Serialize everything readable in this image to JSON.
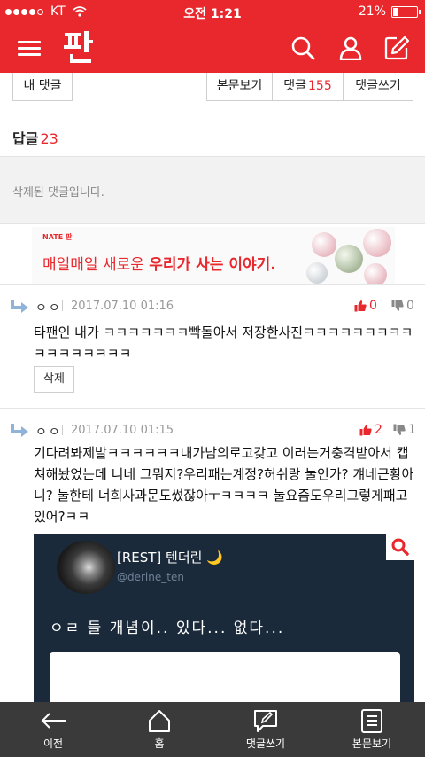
{
  "status_bar": {
    "carrier": "KT",
    "time": "오전 1:21",
    "battery": "21%",
    "battery_level": 0.21
  },
  "header": {
    "logo": "판",
    "icons": [
      "menu-icon",
      "search-icon",
      "user-icon",
      "edit-icon"
    ]
  },
  "buttons": {
    "my_comments": "내 댓글",
    "view_post": "본문보기",
    "comments_label": "댓글",
    "comments_count": "155",
    "write_comment": "댓글쓰기"
  },
  "replies": {
    "label": "답글",
    "count": "23"
  },
  "deleted_notice": "삭제된 댓글입니다.",
  "ad": {
    "brand": "NATE 판",
    "text_plain": "매일매일 새로운 ",
    "text_bold": "우리가 사는 이야기."
  },
  "comments": [
    {
      "author": "ㅇㅇ",
      "date": "2017.07.10 01:16",
      "likes": "0",
      "dislikes": "0",
      "text": "타팬인 내가 ㅋㅋㅋㅋㅋㅋㅋ빡돌아서 저장한사진ㅋㅋㅋㅋㅋㅋㅋㅋㅋㅋㅋㅋㅋㅋㅋㅋㅋ",
      "delete_label": "삭제"
    },
    {
      "author": "ㅇㅇ",
      "date": "2017.07.10 01:15",
      "likes": "2",
      "dislikes": "1",
      "text": "기다려봐제발ㅋㅋㅋㅋㅋㅋ내가남의로고갖고 이러는거충격받아서 캡쳐해놨었는데 니네 그뭐지?우리패는계정?허쉬랑 눌인가? 걔네근황아니? 눌한테 너희사과문도썼잖아ㅜㅋㅋㅋㅋ 눌요즘도우리그렇게패고있어?ㅋㅋ"
    }
  ],
  "embedded_image": {
    "name": "[REST] 텐더린 🌙",
    "handle": "@derine_ten",
    "message": "ㅇㄹ 들 개념이.. 있다... 없다..."
  },
  "bottom_nav": [
    {
      "label": "이전",
      "icon": "back-arrow-icon"
    },
    {
      "label": "홈",
      "icon": "home-icon"
    },
    {
      "label": "댓글쓰기",
      "icon": "write-comment-icon"
    },
    {
      "label": "본문보기",
      "icon": "document-icon"
    }
  ],
  "colors": {
    "brand_red": "#e8282d",
    "bottom_bar": "#3a3a3a"
  }
}
